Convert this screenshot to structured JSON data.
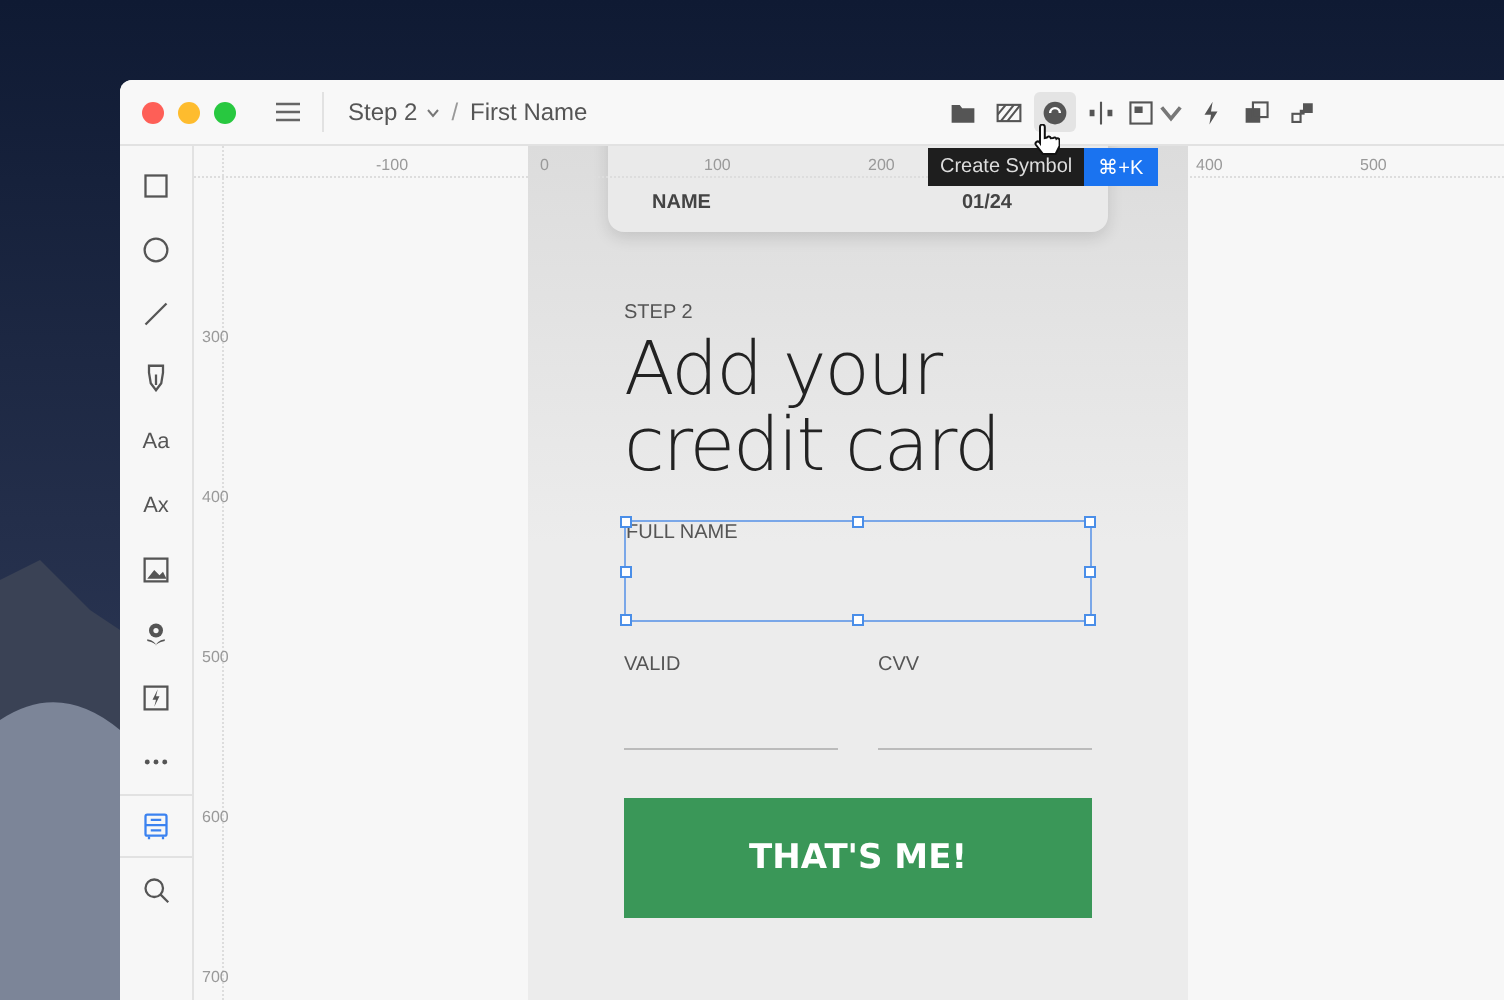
{
  "window": {
    "breadcrumb": [
      {
        "label": "Step 2",
        "dropdown": true
      },
      {
        "label": "First Name",
        "dropdown": false
      }
    ],
    "separator": "/"
  },
  "toolbar": [
    {
      "active": false,
      "dropdown": false
    },
    {
      "active": false,
      "dropdown": false
    },
    {
      "active": true,
      "dropdown": false
    },
    {
      "active": false,
      "dropdown": false
    },
    {
      "active": false,
      "dropdown": true
    },
    {
      "active": false,
      "dropdown": false
    },
    {
      "active": false,
      "dropdown": false
    },
    {
      "active": false,
      "dropdown": false
    }
  ],
  "tooltip": {
    "label": "Create Symbol",
    "shortcut": "⌘+K"
  },
  "tools": [
    {
      "kind": "icon",
      "selected": false
    },
    {
      "kind": "icon",
      "selected": false
    },
    {
      "kind": "icon",
      "selected": false
    },
    {
      "kind": "icon",
      "selected": false
    },
    {
      "kind": "text",
      "label": "Aa",
      "selected": false
    },
    {
      "kind": "text",
      "label": "Ax",
      "selected": false
    },
    {
      "kind": "icon",
      "selected": false
    },
    {
      "kind": "icon",
      "selected": false
    },
    {
      "kind": "icon",
      "selected": false
    },
    {
      "kind": "icon",
      "selected": false
    },
    {
      "kind": "icon",
      "selected": true
    },
    {
      "kind": "icon",
      "selected": false
    }
  ],
  "rulers": {
    "horizontal": [
      "-100",
      "0",
      "100",
      "200",
      "400",
      "500"
    ],
    "vertical": [
      "300",
      "400",
      "500",
      "600",
      "700"
    ]
  },
  "artboard": {
    "card": {
      "name_label": "NAME",
      "expiry": "01/24"
    },
    "step": "STEP 2",
    "heading_lines": [
      "Add your",
      "credit card"
    ],
    "full_name": {
      "label": "FULL NAME",
      "selected": true
    },
    "fields": [
      {
        "label": "VALID"
      },
      {
        "label": "CVV"
      }
    ],
    "button": "THAT'S ME!"
  }
}
